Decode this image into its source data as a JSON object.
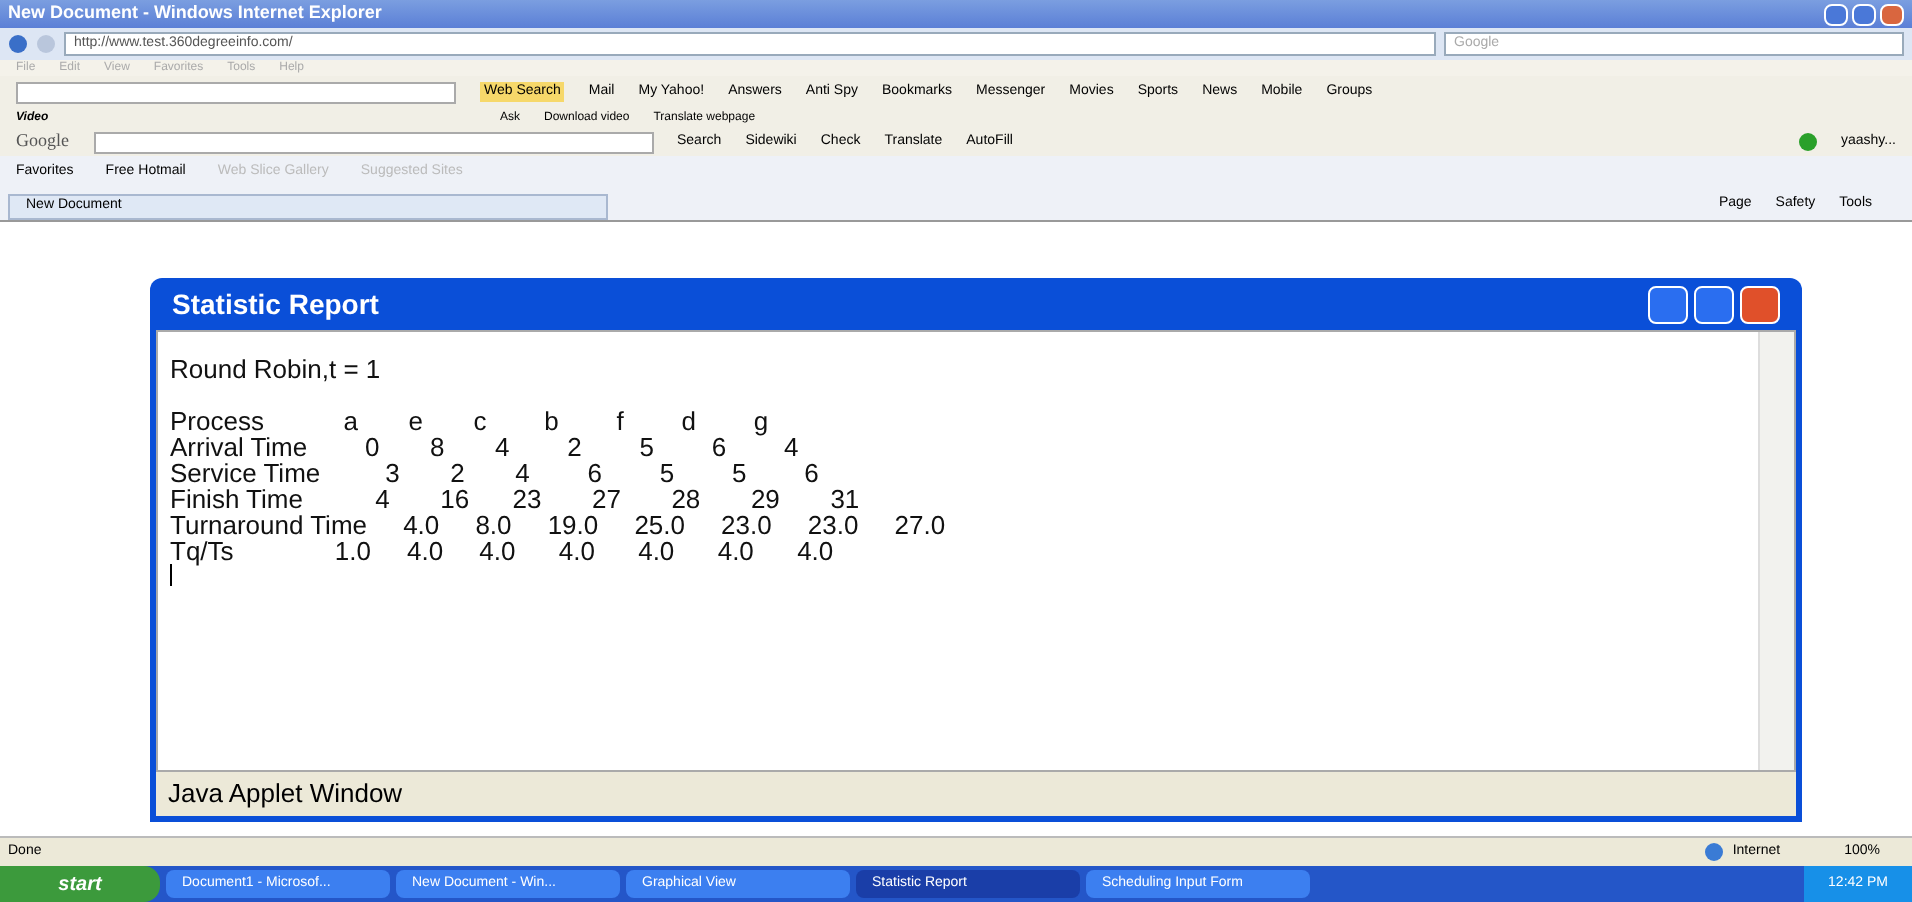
{
  "window": {
    "title": "New Document - Windows Internet Explorer"
  },
  "address_bar": {
    "url": "http://www.test.360degreeinfo.com/",
    "search_placeholder": "Google"
  },
  "menu": [
    "File",
    "Edit",
    "View",
    "Favorites",
    "Tools",
    "Help"
  ],
  "yahoo_toolbar": [
    "Web Search",
    "Mail",
    "My Yahoo!",
    "Answers",
    "Anti Spy",
    "Bookmarks",
    "Messenger",
    "Movies",
    "Sports",
    "News",
    "Mobile",
    "Groups"
  ],
  "video_toolbar": [
    "Video",
    "Ask",
    "Download video",
    "Translate webpage"
  ],
  "google_toolbar": {
    "logo": "Google",
    "items": [
      "Search",
      "Sidewiki",
      "Check",
      "Translate",
      "AutoFill"
    ],
    "user": "yaashy..."
  },
  "favorites_bar": [
    "Favorites",
    "Free Hotmail",
    "Web Slice Gallery",
    "Suggested Sites"
  ],
  "tab": {
    "label": "New Document"
  },
  "command_bar": [
    "Page",
    "Safety",
    "Tools"
  ],
  "applet": {
    "title": "Statistic Report",
    "heading": "Round Robin,t = 1",
    "lines": [
      "Process           a       e       c        b        f        d        g",
      "Arrival Time        0       8       4        2        5        6        4",
      "Service Time         3       2       4        6        5        5        6",
      "Finish Time          4       16      23       27       28       29       31",
      "Turnaround Time     4.0     8.0     19.0     25.0     23.0     23.0     27.0",
      "Tq/Ts              1.0     4.0     4.0      4.0      4.0      4.0      4.0"
    ],
    "status": "Java Applet Window"
  },
  "status_bar": {
    "text": "Done",
    "zone": "Internet",
    "zoom": "100%"
  },
  "taskbar": {
    "start": "start",
    "items": [
      {
        "label": "Document1 - Microsof...",
        "selected": false
      },
      {
        "label": "New Document - Win...",
        "selected": false
      },
      {
        "label": "Graphical View",
        "selected": false
      },
      {
        "label": "Statistic Report",
        "selected": true
      },
      {
        "label": "Scheduling Input Form",
        "selected": false
      }
    ],
    "clock": "12:42 PM"
  }
}
